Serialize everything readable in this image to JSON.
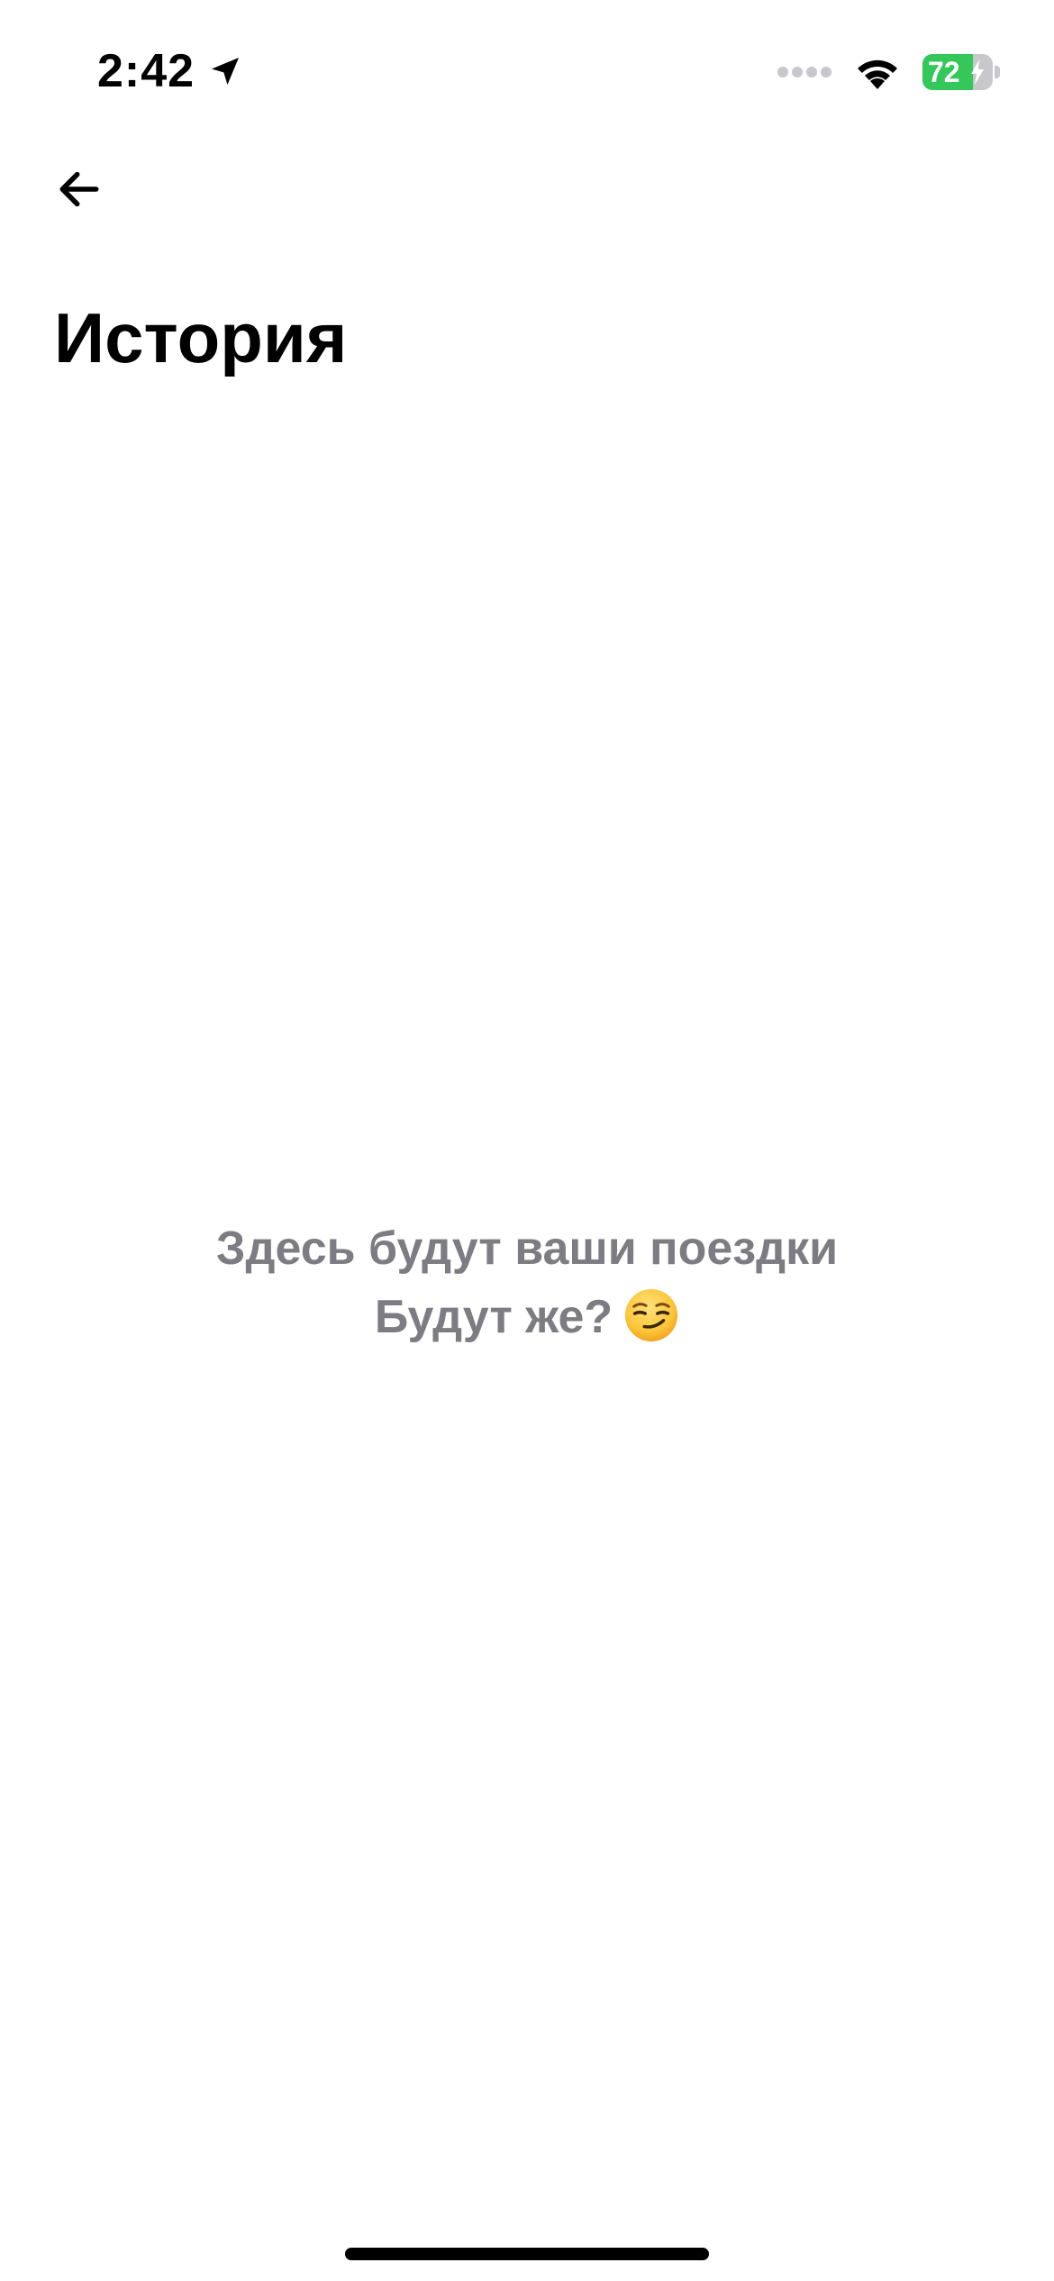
{
  "status_bar": {
    "time": "2:42",
    "battery_level": "72",
    "battery_percent": 72,
    "battery_charging": true,
    "icons": {
      "location": "location-arrow-icon",
      "cellular": "cellular-signal-icon",
      "wifi": "wifi-icon",
      "battery": "battery-icon",
      "charging": "bolt-icon"
    }
  },
  "navigation": {
    "back_icon": "arrow-left-icon"
  },
  "page": {
    "title": "История"
  },
  "empty_state": {
    "line1": "Здесь будут ваши поездки",
    "line2": "Будут же?",
    "emoji_icon": "smirking-face-icon"
  },
  "colors": {
    "background": "#ffffff",
    "text_primary": "#000000",
    "text_secondary": "#7c7c82",
    "battery_green": "#34c759"
  }
}
